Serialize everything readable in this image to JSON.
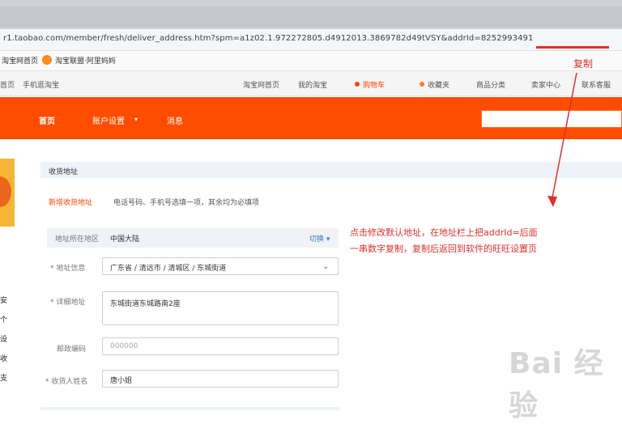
{
  "browser": {
    "url": "r1.taobao.com/member/fresh/deliver_address.htm?spm=a1z02.1.972272805.d4912013.3869782d49tVSY&addrId=8252993491",
    "bookmarks": [
      "淘宝网首页",
      "淘宝联盟·阿里妈妈"
    ]
  },
  "site_nav": {
    "left_items": [
      "首页",
      "手机逛淘宝"
    ],
    "right_items": [
      "淘宝网首页",
      "我的淘宝",
      "购物车",
      "收藏夹",
      "商品分类",
      "卖家中心",
      "联系客服"
    ]
  },
  "orange_nav": {
    "items": [
      "首页",
      "账户设置",
      "消息"
    ]
  },
  "sidebar": {
    "items": [
      "安",
      "个",
      "设",
      "收",
      "支"
    ]
  },
  "address_section": {
    "title": "收货地址",
    "tip_tag": "新增收货地址",
    "tip_text": "电话号码、手机号选填一项，其余均为必填项",
    "country_label": "地址所在地区",
    "country_value": "中国大陆",
    "country_switch": "切换",
    "fields": [
      {
        "label": "* 地址信息",
        "value": "广东省 / 清远市 / 清城区 / 东城街道",
        "type": "select"
      },
      {
        "label": "* 详细地址",
        "value": "东城街道东城路南2座",
        "type": "textarea"
      },
      {
        "label": "邮政编码",
        "value": "000000",
        "type": "input",
        "placeholder": true
      },
      {
        "label": "* 收货人姓名",
        "value": "唐小姐",
        "type": "input"
      }
    ]
  },
  "annotations": {
    "copy_label": "复制",
    "instruction_line1": "点击修改默认地址，在地址栏上把addrId=后面",
    "instruction_line2": "一串数字复制，复制后返回到软件的旺旺设置页",
    "watermark": "Bai 经验",
    "accent_color": "#e0302d",
    "brand_color": "#ff4d00"
  }
}
